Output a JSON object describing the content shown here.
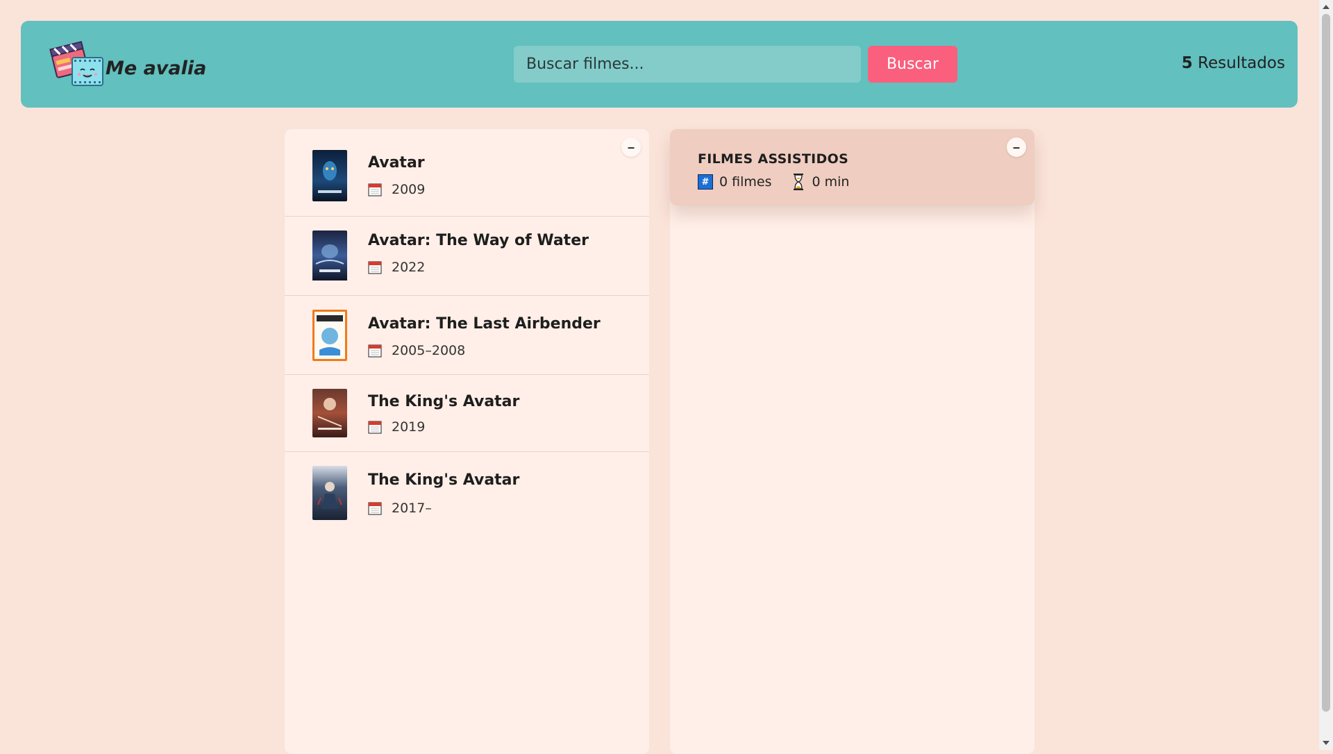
{
  "app": {
    "name": "Me avalia"
  },
  "search": {
    "placeholder": "Buscar filmes...",
    "button_label": "Buscar"
  },
  "results": {
    "count": "5",
    "label": "Resultados"
  },
  "movie_list": {
    "toggle_label": "–",
    "items": [
      {
        "title": "Avatar",
        "year": "2009"
      },
      {
        "title": "Avatar: The Way of Water",
        "year": "2022"
      },
      {
        "title": "Avatar: The Last Airbender",
        "year": "2005–2008"
      },
      {
        "title": "The King's Avatar",
        "year": "2019"
      },
      {
        "title": "The King's Avatar",
        "year": "2017–"
      }
    ]
  },
  "watched": {
    "toggle_label": "–",
    "title": "FILMES ASSISTIDOS",
    "count_text": "0 filmes",
    "runtime_text": "0 min"
  },
  "colors": {
    "background": "#fae3d9",
    "navbar": "#62c0bf",
    "accent_button": "#fa5f7e",
    "panel": "#ffefe8",
    "summary": "#efcdc0"
  },
  "icons": {
    "logo": "clapperboard-logo",
    "calendar": "calendar-icon",
    "hash": "hash-icon",
    "hourglass": "hourglass-icon"
  }
}
